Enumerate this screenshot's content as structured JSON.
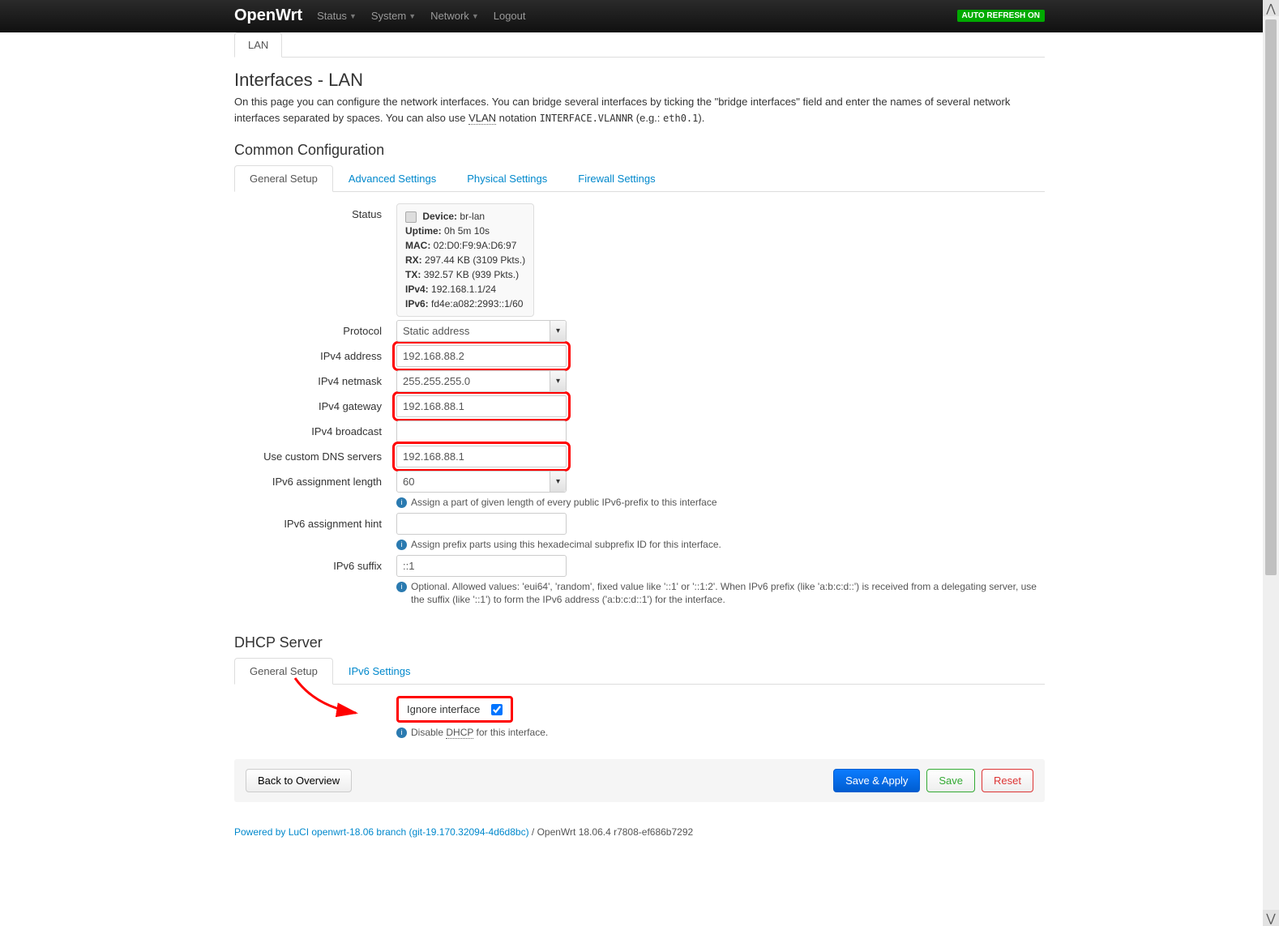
{
  "nav": {
    "brand": "OpenWrt",
    "items": [
      "Status",
      "System",
      "Network",
      "Logout"
    ],
    "refresh": "AUTO REFRESH ON"
  },
  "topTab": "LAN",
  "page": {
    "title": "Interfaces - LAN",
    "desc1a": "On this page you can configure the network interfaces. You can bridge several interfaces by ticking the \"bridge interfaces\" field and enter the names of several network interfaces separated by spaces. You can also use ",
    "desc1_abbr": "VLAN",
    "desc1b": " notation ",
    "desc1_code": "INTERFACE.VLANNR",
    "desc1c": " (e.g.: ",
    "desc1_code2": "eth0.1",
    "desc1d": ")."
  },
  "section1": {
    "heading": "Common Configuration",
    "tabs": [
      "General Setup",
      "Advanced Settings",
      "Physical Settings",
      "Firewall Settings"
    ]
  },
  "status": {
    "label": "Status",
    "device_label": "Device:",
    "device": "br-lan",
    "uptime_label": "Uptime:",
    "uptime": "0h 5m 10s",
    "mac_label": "MAC:",
    "mac": "02:D0:F9:9A:D6:97",
    "rx_label": "RX:",
    "rx": "297.44 KB (3109 Pkts.)",
    "tx_label": "TX:",
    "tx": "392.57 KB (939 Pkts.)",
    "ipv4_label": "IPv4:",
    "ipv4": "192.168.1.1/24",
    "ipv6_label": "IPv6:",
    "ipv6": "fd4e:a082:2993::1/60"
  },
  "form": {
    "protocol_label": "Protocol",
    "protocol_value": "Static address",
    "ipv4addr_label": "IPv4 address",
    "ipv4addr_value": "192.168.88.2",
    "ipv4mask_label": "IPv4 netmask",
    "ipv4mask_value": "255.255.255.0",
    "ipv4gw_label": "IPv4 gateway",
    "ipv4gw_value": "192.168.88.1",
    "ipv4bcast_label": "IPv4 broadcast",
    "ipv4bcast_value": "",
    "dns_label": "Use custom DNS servers",
    "dns_value": "192.168.88.1",
    "ipv6len_label": "IPv6 assignment length",
    "ipv6len_value": "60",
    "ipv6len_hint": "Assign a part of given length of every public IPv6-prefix to this interface",
    "ipv6hint_label": "IPv6 assignment hint",
    "ipv6hint_value": "",
    "ipv6hint_hint": "Assign prefix parts using this hexadecimal subprefix ID for this interface.",
    "ipv6suffix_label": "IPv6 suffix",
    "ipv6suffix_value": "::1",
    "ipv6suffix_hint": "Optional. Allowed values: 'eui64', 'random', fixed value like '::1' or '::1:2'. When IPv6 prefix (like 'a:b:c:d::') is received from a delegating server, use the suffix (like '::1') to form the IPv6 address ('a:b:c:d::1') for the interface."
  },
  "dhcp": {
    "heading": "DHCP Server",
    "tabs": [
      "General Setup",
      "IPv6 Settings"
    ],
    "ignore_label": "Ignore interface",
    "ignore_checked": true,
    "ignore_hint_a": "Disable ",
    "ignore_hint_abbr": "DHCP",
    "ignore_hint_b": " for this interface."
  },
  "actions": {
    "back": "Back to Overview",
    "save_apply": "Save & Apply",
    "save": "Save",
    "reset": "Reset"
  },
  "footer": {
    "a": "Powered by LuCI openwrt-18.06 branch (git-19.170.32094-4d6d8bc)",
    "b": " / OpenWrt 18.06.4 r7808-ef686b7292"
  }
}
